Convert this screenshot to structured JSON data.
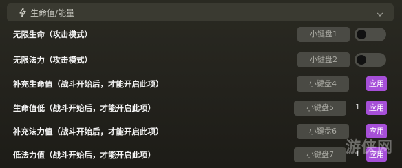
{
  "header": {
    "title": "生命值/能量",
    "icons": {
      "left": "bolt-icon",
      "right": "chevron-down-icon"
    }
  },
  "rows": [
    {
      "label": "无限生命（攻击模式）",
      "key": "小键盘1",
      "control": "toggle",
      "toggle_on": false
    },
    {
      "label": "无限法力（攻击模式）",
      "key": "小键盘2",
      "control": "toggle",
      "toggle_on": false
    },
    {
      "label": "补充生命值（战斗开始后，才能开启此项）",
      "key": "小键盘4",
      "control": "apply",
      "apply_label": "应用"
    },
    {
      "label": "生命值低（战斗开始后，才能开启此项）",
      "key": "小键盘5",
      "control": "apply",
      "value": "1",
      "apply_label": "应用"
    },
    {
      "label": "补充法力值（战斗开始后，才能开启此项）",
      "key": "小键盘6",
      "control": "apply",
      "apply_label": "应用"
    },
    {
      "label": "低法力值（战斗开始后，才能开启此项）",
      "key": "小键盘7",
      "control": "apply",
      "value": "1",
      "apply_label": "应用"
    }
  ],
  "watermark": "游侠网",
  "colors": {
    "apply": "#a64fd8",
    "panel": "#25241e",
    "header": "#3a3a31"
  }
}
